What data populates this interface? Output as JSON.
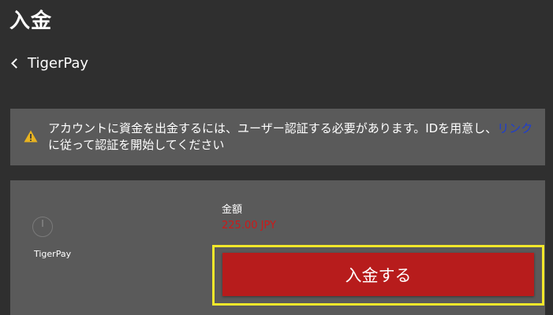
{
  "header": {
    "title": "入金"
  },
  "back": {
    "label": "TigerPay",
    "icon": "chevron-left-icon"
  },
  "warning": {
    "icon": "warning-triangle-icon",
    "icon_color": "#e8b320",
    "text_before": "アカウントに資金を出金するには、ユーザー認証する必要があります。IDを用意し、",
    "link_text": "リンク",
    "text_after": "に従って認証を開始してください",
    "link_color": "#1e3ecf"
  },
  "payment": {
    "method_icon": "clock-icon",
    "method_name": "TigerPay",
    "amount_label": "金額",
    "amount_value": "225.00 JPY",
    "amount_color": "#cc1a1a",
    "button_label": "入金する",
    "button_color": "#b71c1c",
    "highlight_color": "#f2e82a"
  }
}
